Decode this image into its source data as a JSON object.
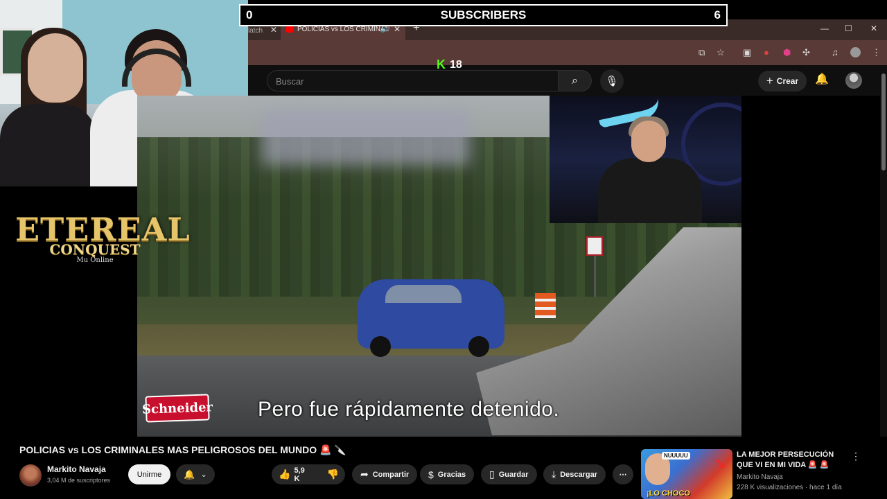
{
  "overlay": {
    "sub_left": "0",
    "sub_label": "SUBSCRIBERS",
    "sub_right": "6",
    "kick_viewers": "18",
    "logo_line1": "ETEREAL",
    "logo_line2": "CONQUEST",
    "logo_line3": "Mu Online"
  },
  "browser": {
    "inactive_tab_label": "latch",
    "active_tab_label": "POLICIAS vs LOS CRIMINAL",
    "close_glyph": "✕",
    "new_tab_glyph": "+",
    "window_controls": [
      "—",
      "☐",
      "✕"
    ]
  },
  "header": {
    "search_placeholder": "Buscar",
    "create_label": "Crear"
  },
  "video": {
    "caption": "Pero fue rápidamente detenido.",
    "sponsor": "Schneider"
  },
  "info": {
    "title": "POLICIAS vs LOS CRIMINALES MAS PELIGROSOS DEL MUNDO 🚨 🔪",
    "channel_name": "Markito Navaja",
    "channel_subs": "3,04 M de suscriptores",
    "join_label": "Unirme",
    "likes": "5,9 K",
    "share_label": "Compartir",
    "thanks_label": "Gracias",
    "save_label": "Guardar",
    "download_label": "Descargar"
  },
  "recommended": {
    "title": "LA MEJOR PERSECUCIÓN QUE VI EN MI VIDA 🚨 🚨",
    "channel": "Markito Navaja",
    "meta": "228 K visualizaciones · hace 1 día",
    "thumb_top": "NUUUUU",
    "thumb_caption": "¡LO CHOCO"
  },
  "colors": {
    "kick_green": "#53fc18",
    "youtube_bg": "#0f0f0f",
    "chip_bg": "#272727",
    "browser_frame": "#5a3a36"
  }
}
